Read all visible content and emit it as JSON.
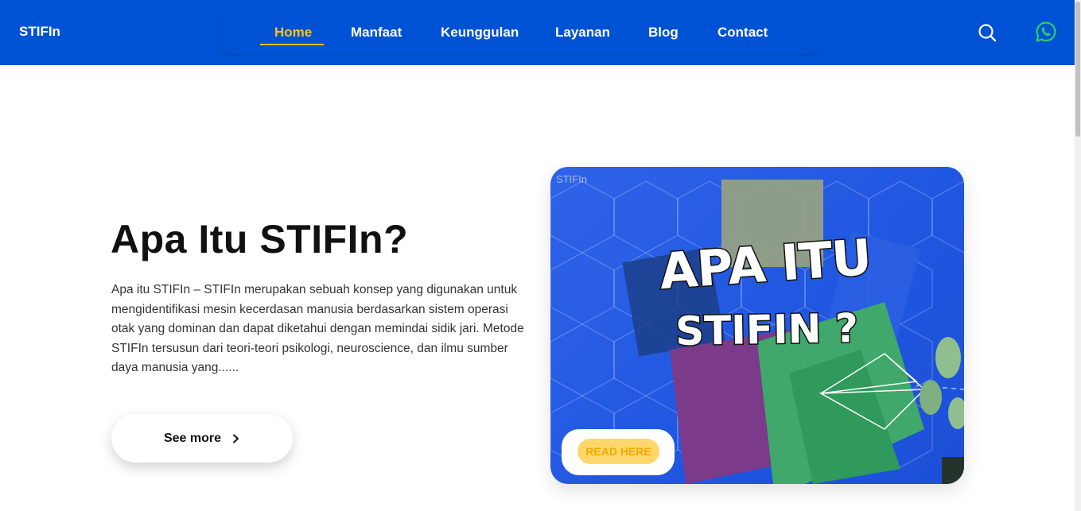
{
  "brand": "STIFIn",
  "nav": {
    "items": [
      {
        "label": "Home",
        "active": true
      },
      {
        "label": "Manfaat",
        "active": false
      },
      {
        "label": "Keunggulan",
        "active": false
      },
      {
        "label": "Layanan",
        "active": false
      },
      {
        "label": "Blog",
        "active": false
      },
      {
        "label": "Contact",
        "active": false
      }
    ],
    "search_icon": "search-icon",
    "whatsapp_icon": "whatsapp-icon"
  },
  "hero": {
    "title": "Apa Itu STIFIn?",
    "description": "Apa itu STIFIn – STIFIn merupakan sebuah konsep yang digunakan untuk mengidentifikasi mesin kecerdasan manusia berdasarkan sistem operasi otak yang dominan dan dapat diketahui dengan memindai sidik jari. Metode STIFIn tersusun dari teori-teori psikologi, neuroscience, dan ilmu sumber daya manusia yang......",
    "button_label": "See more"
  },
  "card": {
    "watermark": "STIFIn",
    "headline_line1": "APA ITU",
    "headline_line2": "STIFIN ?",
    "button_label": "READ HERE"
  },
  "colors": {
    "navbar": "#0052d4",
    "active_nav": "#f5c518",
    "whatsapp": "#25d366"
  }
}
